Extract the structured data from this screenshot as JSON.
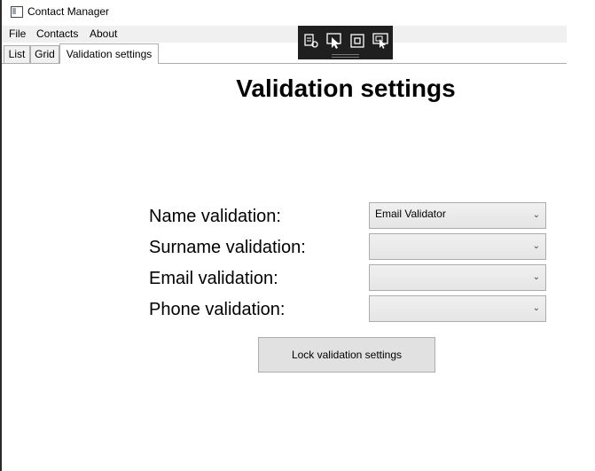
{
  "window": {
    "title": "Contact Manager"
  },
  "menu": {
    "items": [
      "File",
      "Contacts",
      "About"
    ]
  },
  "tabs": [
    {
      "label": "List",
      "active": false
    },
    {
      "label": "Grid",
      "active": false
    },
    {
      "label": "Validation settings",
      "active": true
    }
  ],
  "page": {
    "title": "Validation settings"
  },
  "form": {
    "fields": [
      {
        "label": "Name validation:",
        "selected": "Email Validator"
      },
      {
        "label": "Surname validation:",
        "selected": ""
      },
      {
        "label": "Email validation:",
        "selected": ""
      },
      {
        "label": "Phone validation:",
        "selected": ""
      }
    ],
    "lock_button": "Lock validation settings"
  },
  "debug_toolbar": {
    "tools": [
      "live-visual-tree-icon",
      "select-element-icon",
      "display-layout-adorners-icon",
      "track-focused-element-icon"
    ]
  },
  "colors": {
    "toolbar_bg": "#1f1f1f",
    "menubar_bg": "#f0f0f0",
    "combo_border": "#acacac"
  }
}
